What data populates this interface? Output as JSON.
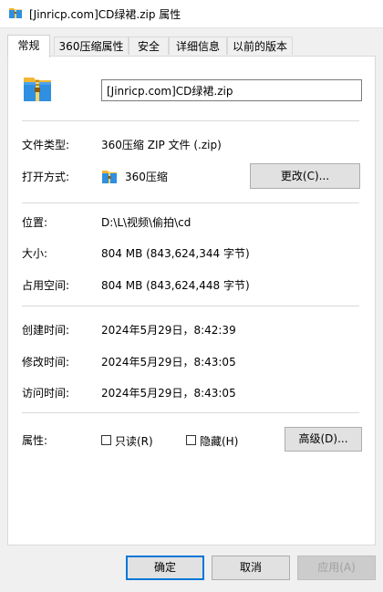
{
  "window": {
    "title": "[Jinricp.com]CD绿裙.zip 属性"
  },
  "tabs": [
    {
      "label": "常规"
    },
    {
      "label": "360压缩属性"
    },
    {
      "label": "安全"
    },
    {
      "label": "详细信息"
    },
    {
      "label": "以前的版本"
    }
  ],
  "general": {
    "file_name": "[Jinricp.com]CD绿裙.zip",
    "type_label": "文件类型:",
    "type_value": "360压缩 ZIP 文件 (.zip)",
    "open_with_label": "打开方式:",
    "open_with_value": "360压缩",
    "change_button": "更改(C)...",
    "location_label": "位置:",
    "location_value": "D:\\L\\视频\\偷拍\\cd",
    "size_label": "大小:",
    "size_value": "804 MB (843,624,344 字节)",
    "disk_size_label": "占用空间:",
    "disk_size_value": "804 MB (843,624,448 字节)",
    "created_label": "创建时间:",
    "created_value": "2024年5月29日，8:42:39",
    "modified_label": "修改时间:",
    "modified_value": "2024年5月29日，8:43:05",
    "accessed_label": "访问时间:",
    "accessed_value": "2024年5月29日，8:43:05",
    "attributes_label": "属性:",
    "readonly_label": "只读(R)",
    "hidden_label": "隐藏(H)",
    "advanced_button": "高级(D)..."
  },
  "footer": {
    "ok": "确定",
    "cancel": "取消",
    "apply": "应用(A)"
  },
  "icons": {
    "title": "archive-icon",
    "large": "archive-icon",
    "open_with": "archive-icon"
  },
  "colors": {
    "accent": "#0078d7",
    "archive_yellow": "#f2b632",
    "archive_blue": "#2f8fe0"
  }
}
